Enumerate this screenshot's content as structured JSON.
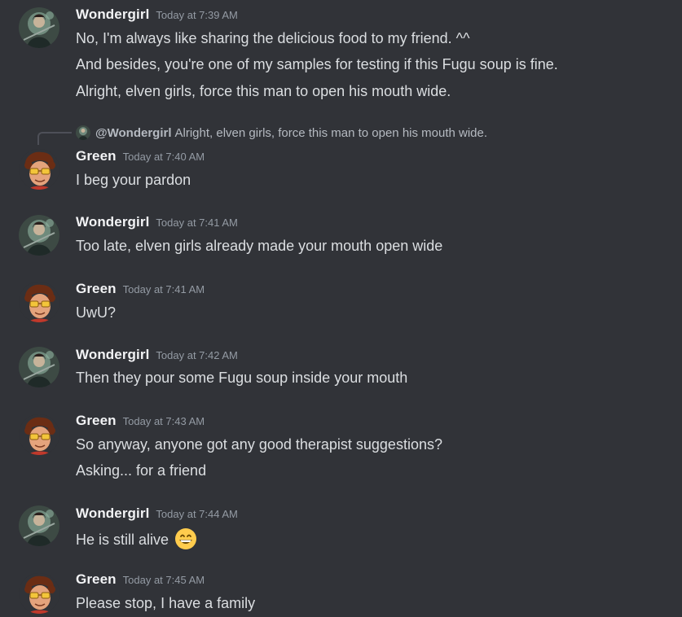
{
  "messages": [
    {
      "user": "Wondergirl",
      "time": "Today at 7:39 AM",
      "lines": [
        "No, I'm always like sharing the delicious food to my friend. ^^",
        "And besides, you're one of my samples for testing if this Fugu soup is fine.",
        "Alright, elven girls, force this man to open his mouth wide."
      ]
    },
    {
      "user": "Green",
      "time": "Today at 7:40 AM",
      "reply": {
        "user": "@Wondergirl",
        "text": "Alright, elven girls, force this man to open his mouth wide."
      },
      "lines": [
        "I beg your pardon"
      ]
    },
    {
      "user": "Wondergirl",
      "time": "Today at 7:41 AM",
      "lines": [
        "Too late, elven girls already made your mouth open wide"
      ]
    },
    {
      "user": "Green",
      "time": "Today at 7:41 AM",
      "lines": [
        "UwU?"
      ]
    },
    {
      "user": "Wondergirl",
      "time": "Today at 7:42 AM",
      "lines": [
        "Then they pour some Fugu soup inside your mouth"
      ]
    },
    {
      "user": "Green",
      "time": "Today at 7:43 AM",
      "lines": [
        "So anyway, anyone got any good therapist suggestions?",
        "Asking... for a friend"
      ]
    },
    {
      "user": "Wondergirl",
      "time": "Today at 7:44 AM",
      "lines": [
        "He is still alive"
      ],
      "emoji": "grinning-face-emoji"
    },
    {
      "user": "Green",
      "time": "Today at 7:45 AM",
      "lines": [
        "Please stop, I have a family"
      ]
    }
  ],
  "colors": {
    "background": "#313338",
    "username": "#f2f3f5",
    "text": "#dbdee1",
    "timestamp": "#949ba4"
  }
}
